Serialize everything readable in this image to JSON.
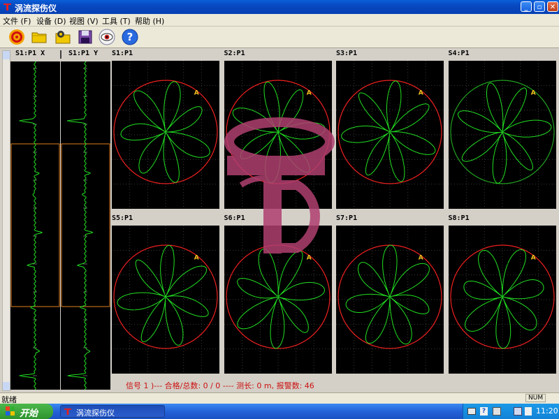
{
  "window": {
    "title": "涡流探伤仪"
  },
  "menu": [
    "文件 (F)",
    "设备 (D)",
    "视图 (V)",
    "工具 (T)",
    "帮助 (H)"
  ],
  "toolbar": {
    "icons": [
      "target-icon",
      "folder-icon",
      "gear-folder-icon",
      "disk-icon",
      "eye-icon",
      "help-icon"
    ],
    "help_glyph": "?"
  },
  "strips": [
    {
      "label": "S1:P1 X"
    },
    {
      "label": "S1:P1 Y"
    }
  ],
  "plots": [
    {
      "label": "S1:P1",
      "marker": "A"
    },
    {
      "label": "S2:P1",
      "marker": "A"
    },
    {
      "label": "S3:P1",
      "marker": "A"
    },
    {
      "label": "S4:P1",
      "marker": "A"
    },
    {
      "label": "S5:P1",
      "marker": "A"
    },
    {
      "label": "S6:P1",
      "marker": "A"
    },
    {
      "label": "S7:P1",
      "marker": "A"
    },
    {
      "label": "S8:P1",
      "marker": "A"
    }
  ],
  "info": {
    "text": "信号 1 )--- 合格/总数: 0 / 0 ---- 测长: 0 m, 报警数: 46"
  },
  "status": {
    "left": "就绪",
    "num": "NUM"
  },
  "taskbar": {
    "start": "开始",
    "app": "涡流探伤仪",
    "clock": "11:20"
  },
  "colors": {
    "trace": "#22e022",
    "circle": "#ee2020",
    "marker": "#f0c020",
    "window_blue": "#0848c0"
  }
}
